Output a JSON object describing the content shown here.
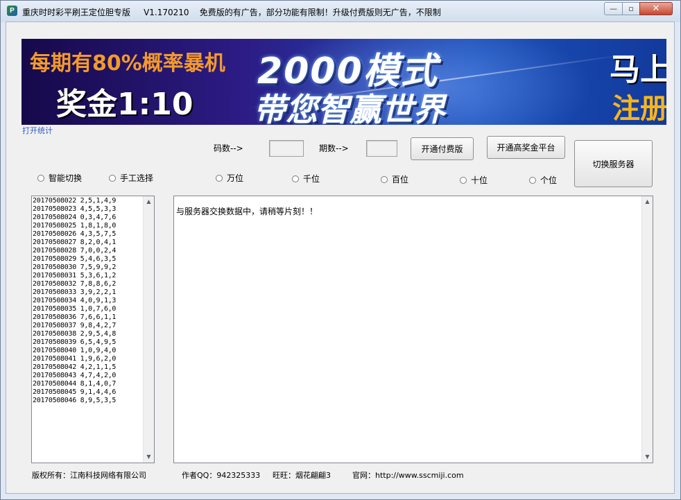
{
  "window": {
    "title": "重庆时时彩平刷王定位胆专版     V1.170210    免费版的有广告，部分功能有限制！升级付费版则无广告，不限制",
    "icon_glyph": "P",
    "minimize_glyph": "—",
    "maximize_glyph": "▫",
    "close_glyph": "✕"
  },
  "banner": {
    "line1": "每期有80%概率暴机",
    "line2": "奖金1:10",
    "headline": "2000模式",
    "subline": "带您智赢世界",
    "right_top": "马上",
    "right_bottom": "注册"
  },
  "link_text": "打开统计",
  "controls": {
    "code_label": "码数-->",
    "period_label": "期数-->",
    "paid_button": "开通付费版",
    "platform_button": "开通高奖金平台",
    "switch_server_button": "切换服务器"
  },
  "modes": [
    {
      "label": "智能切换"
    },
    {
      "label": "手工选择"
    }
  ],
  "positions": [
    {
      "label": "万位"
    },
    {
      "label": "千位"
    },
    {
      "label": "百位"
    },
    {
      "label": "十位"
    },
    {
      "label": "个位"
    }
  ],
  "history": [
    "20170508022 2,5,1,4,9",
    "20170508023 4,5,5,3,3",
    "20170508024 0,3,4,7,6",
    "20170508025 1,8,1,8,0",
    "20170508026 4,3,5,7,5",
    "20170508027 8,2,0,4,1",
    "20170508028 7,0,0,2,4",
    "20170508029 5,4,6,3,5",
    "20170508030 7,5,9,9,2",
    "20170508031 5,3,6,1,2",
    "20170508032 7,8,8,6,2",
    "20170508033 3,9,2,2,1",
    "20170508034 4,0,9,1,3",
    "20170508035 1,0,7,6,0",
    "20170508036 7,6,6,1,1",
    "20170508037 9,8,4,2,7",
    "20170508038 2,9,5,4,8",
    "20170508039 6,5,4,9,5",
    "20170508040 1,0,9,4,0",
    "20170508041 1,9,6,2,0",
    "20170508042 4,2,1,1,5",
    "20170508043 4,7,4,2,0",
    "20170508044 8,1,4,0,7",
    "20170508045 9,1,4,4,6",
    "20170508046 8,9,5,3,5"
  ],
  "message": "与服务器交换数据中，请稍等片刻！！",
  "footer": {
    "copyright": "版权所有：江南科技网络有限公司",
    "qq": "作者QQ：942325333",
    "wangwang": "旺旺：烟花翩翩3",
    "website": "官网：http://www.sscmiji.com"
  },
  "scroll": {
    "up": "▲",
    "down": "▼"
  }
}
